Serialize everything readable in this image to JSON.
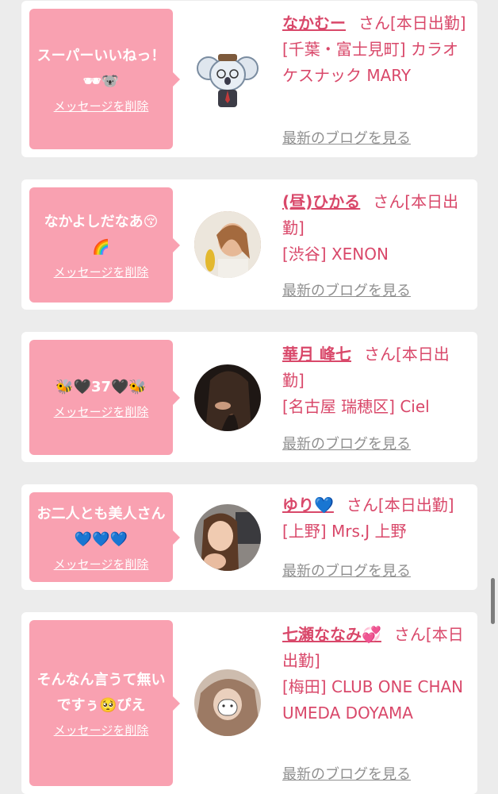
{
  "delete_label": "メッセージを削除",
  "blog_label": "最新のブログを見る",
  "cards": [
    {
      "message": "スーパーいいねっ！🕶🐨",
      "name": "なかむー",
      "honorific": "さん[本日出勤]",
      "shop": "[千葉・富士見町] カラオケスナック MARY",
      "avatar_icon": "koala-illustration"
    },
    {
      "message": "なかよしだなあ😚🌈",
      "name": "(昼)ひかる",
      "honorific": "さん[本日出勤]",
      "shop": "[渋谷] XENON",
      "avatar_icon": "woman-photo"
    },
    {
      "message": "🐝🖤37🖤🐝",
      "name": "華月 峰七",
      "honorific": "さん[本日出勤]",
      "shop": "[名古屋 瑞穂区] Ciel",
      "avatar_icon": "woman-photo"
    },
    {
      "message": "お二人とも美人さん💙💙💙",
      "name": "ゆり💙",
      "honorific": "さん[本日出勤]",
      "shop": "[上野] Mrs.J 上野",
      "avatar_icon": "woman-photo"
    },
    {
      "message": "そんなん言うて無いですぅ🥺ぴえ",
      "name": "七瀬ななみ💞",
      "honorific": "さん[本日出勤]",
      "shop": "[梅田] CLUB ONE CHAN UMEDA DOYAMA",
      "avatar_icon": "woman-photo"
    }
  ],
  "colors": {
    "bubble": "#f9a1b1",
    "name_text": "#d9486a",
    "link_gray": "#8f8f8f",
    "page_bg": "#ececec"
  }
}
